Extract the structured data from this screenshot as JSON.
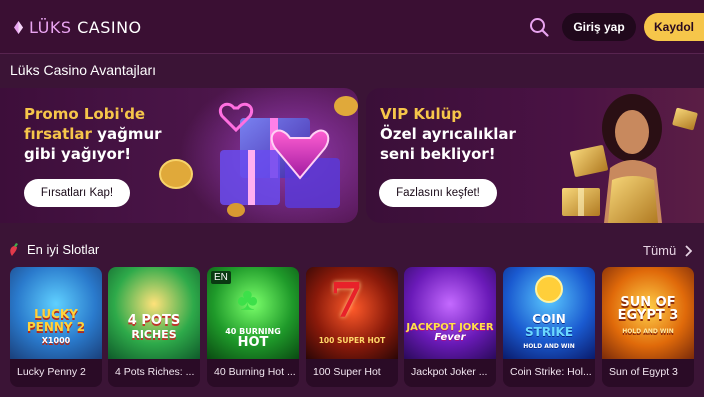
{
  "header": {
    "logo_part1": "LÜKS",
    "logo_part2": "CASINO",
    "login_label": "Giriş yap",
    "register_label": "Kaydol"
  },
  "advantages": {
    "title": "Lüks Casino Avantajları",
    "promos": [
      {
        "title_highlight_1": "Promo Lobi'de",
        "title_highlight_2": "fırsatlar",
        "title_rest_1": " yağmur",
        "title_rest_2": "gibi yağıyor!",
        "button_label": "Fırsatları Kap!"
      },
      {
        "title_highlight_1": "VIP Kulüp",
        "title_rest_1": "Özel ayrıcalıklar",
        "title_rest_2": "seni bekliyor!",
        "button_label": "Fazlasını keşfet!"
      }
    ]
  },
  "slots": {
    "title": "En iyi Slotlar",
    "all_label": "Tümü",
    "games": [
      {
        "name": "Lucky Penny 2",
        "art_line1": "LUCKY",
        "art_line2": "PENNY 2",
        "art_line3": "X1000"
      },
      {
        "name": "4 Pots Riches: ...",
        "art_line1": "4 POTS",
        "art_line2": "RICHES"
      },
      {
        "name": "40 Burning Hot ...",
        "badge": "EN",
        "art_line1": "40 BURNING",
        "art_line2": "HOT"
      },
      {
        "name": "100 Super Hot",
        "art_line1": "100 SUPER HOT"
      },
      {
        "name": "Jackpot Joker ...",
        "art_line1": "JACKPOT JOKER",
        "art_line2": "Fever"
      },
      {
        "name": "Coin Strike: Hol...",
        "art_line1": "COIN",
        "art_line2": "STRIKE",
        "art_line3": "HOLD AND WIN"
      },
      {
        "name": "Sun of Egypt 3",
        "art_line1": "SUN OF",
        "art_line2": "EGYPT 3",
        "art_line3": "HOLD AND WIN"
      }
    ]
  },
  "colors": {
    "background": "#3b1436",
    "accent_yellow": "#f6c64a",
    "logo_pink": "#e9a4f0"
  }
}
